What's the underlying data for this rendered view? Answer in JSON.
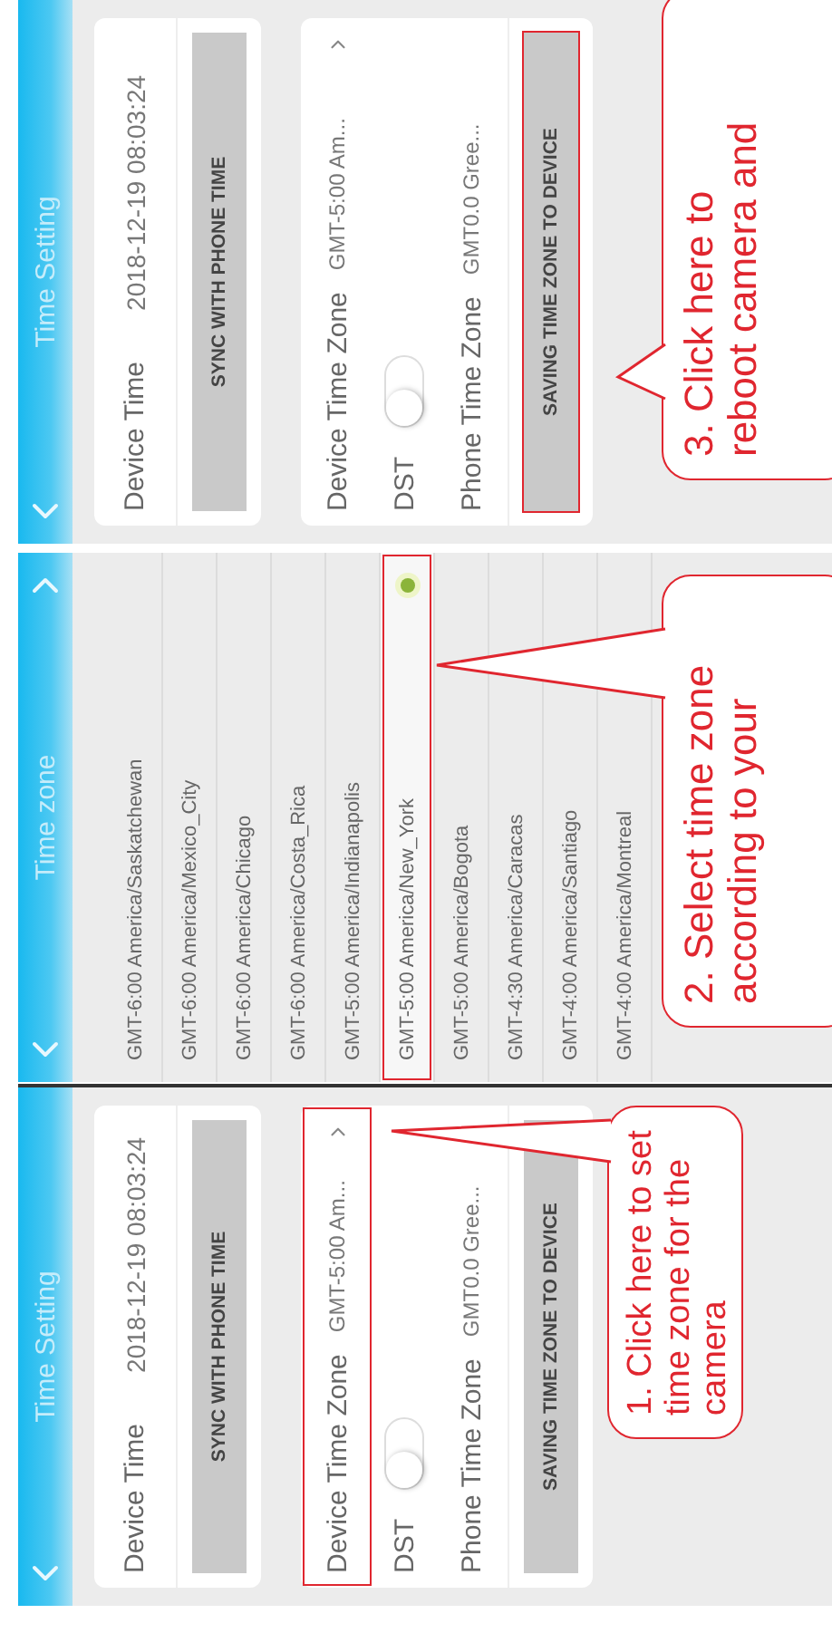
{
  "panels": [
    {
      "kind": "settings",
      "title": "Time Setting",
      "device_time": {
        "label": "Device Time",
        "value": "2018-12-19 08:03:24"
      },
      "sync_button": "SYNC WITH PHONE TIME",
      "rows": [
        {
          "kind": "link",
          "label": "Device Time Zone",
          "value": "GMT-5:00 Am...",
          "highlighted": true
        },
        {
          "kind": "toggle",
          "label": "DST",
          "on": false,
          "highlighted": false
        },
        {
          "kind": "text",
          "label": "Phone Time Zone",
          "value": "GMT0.0 Gree...",
          "highlighted": false
        }
      ],
      "save_button": {
        "label": "SAVING TIME ZONE TO DEVICE",
        "highlighted": false
      },
      "callout": [
        "1. Click here to set",
        "time zone for the",
        "camera"
      ]
    },
    {
      "kind": "list",
      "title": "Time zone",
      "rows": [
        {
          "label": "GMT-6:00 America/Saskatchewan",
          "selected": false,
          "highlighted": false
        },
        {
          "label": "GMT-6:00 America/Mexico_City",
          "selected": false,
          "highlighted": false
        },
        {
          "label": "GMT-6:00 America/Chicago",
          "selected": false,
          "highlighted": false
        },
        {
          "label": "GMT-6:00 America/Costa_Rica",
          "selected": false,
          "highlighted": false
        },
        {
          "label": "GMT-5:00 America/Indianapolis",
          "selected": false,
          "highlighted": false
        },
        {
          "label": "GMT-5:00 America/New_York",
          "selected": true,
          "highlighted": true
        },
        {
          "label": "GMT-5:00 America/Bogota",
          "selected": false,
          "highlighted": false
        },
        {
          "label": "GMT-4:30 America/Caracas",
          "selected": false,
          "highlighted": false
        },
        {
          "label": "GMT-4:00 America/Santiago",
          "selected": false,
          "highlighted": false
        },
        {
          "label": "GMT-4:00 America/Montreal",
          "selected": false,
          "highlighted": false
        }
      ],
      "callout": [
        "2. Select time zone",
        "according to your"
      ]
    },
    {
      "kind": "settings",
      "title": "Time Setting",
      "device_time": {
        "label": "Device Time",
        "value": "2018-12-19 08:03:24"
      },
      "sync_button": "SYNC WITH PHONE TIME",
      "rows": [
        {
          "kind": "link",
          "label": "Device Time Zone",
          "value": "GMT-5:00 Am...",
          "highlighted": false
        },
        {
          "kind": "toggle",
          "label": "DST",
          "on": false,
          "highlighted": false
        },
        {
          "kind": "text",
          "label": "Phone Time Zone",
          "value": "GMT0.0 Gree...",
          "highlighted": false
        }
      ],
      "save_button": {
        "label": "SAVING TIME ZONE TO DEVICE",
        "highlighted": true
      },
      "callout": [
        "3. Click here to",
        "reboot camera and"
      ]
    }
  ]
}
